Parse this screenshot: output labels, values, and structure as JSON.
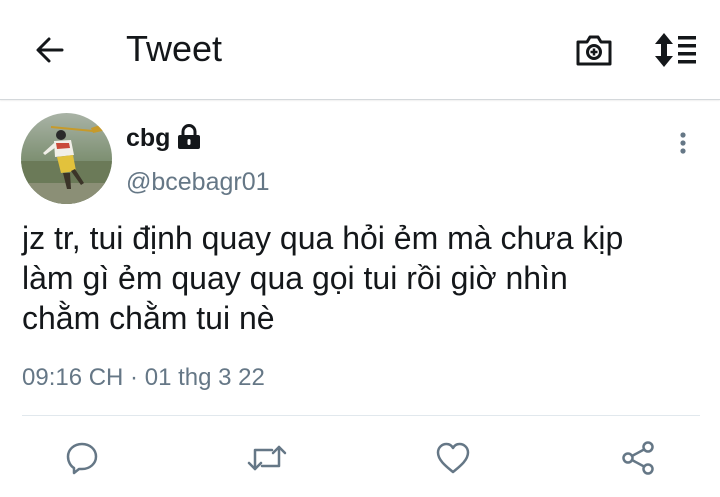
{
  "header": {
    "title": "Tweet"
  },
  "tweet": {
    "display_name": "cbg",
    "handle": "@bcebagr01",
    "text_lines": [
      "jz tr, tui định quay qua hỏi ẻm mà chưa kịp",
      "làm gì ẻm quay qua gọi tui rồi giờ nhìn",
      "chằm chằm tui nè"
    ],
    "timestamp": "09:16 CH · 01 thg 3 22",
    "protected": true
  },
  "icons": {
    "back": "arrow-left-icon",
    "camera": "camera-add-icon",
    "sort": "sort-icon",
    "lock": "lock-icon",
    "more": "more-vertical-icon",
    "reply": "reply-icon",
    "retweet": "retweet-icon",
    "like": "heart-icon",
    "share": "share-icon"
  },
  "colors": {
    "text_primary": "#14171a",
    "text_secondary": "#657786",
    "icon_gray": "#657786",
    "divider": "#e1e8ed"
  }
}
